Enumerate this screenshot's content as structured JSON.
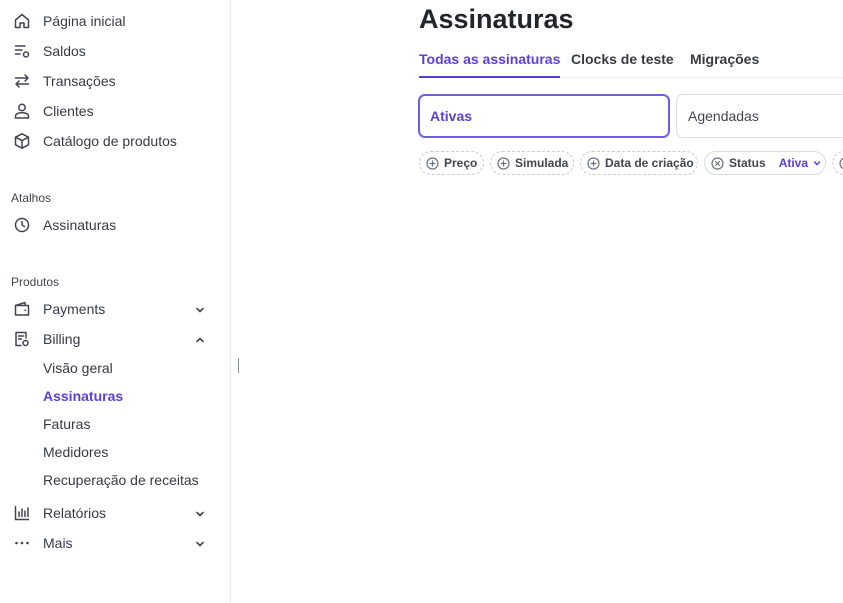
{
  "sidebar": {
    "nav": [
      {
        "label": "Página inicial",
        "icon": "home-icon"
      },
      {
        "label": "Saldos",
        "icon": "balance-icon"
      },
      {
        "label": "Transações",
        "icon": "transactions-icon"
      },
      {
        "label": "Clientes",
        "icon": "customer-icon"
      },
      {
        "label": "Catálogo de produtos",
        "icon": "product-box-icon"
      }
    ],
    "shortcuts_title": "Atalhos",
    "shortcuts": [
      {
        "label": "Assinaturas",
        "icon": "clock-icon"
      }
    ],
    "products_title": "Produtos",
    "products": [
      {
        "label": "Payments",
        "icon": "wallet-icon",
        "expanded": false
      },
      {
        "label": "Billing",
        "icon": "invoice-icon",
        "expanded": true
      },
      {
        "label": "Relatórios",
        "icon": "bar-chart-icon",
        "expanded": false
      },
      {
        "label": "Mais",
        "icon": "more-dots-icon",
        "expanded": false
      }
    ],
    "billing_subitems": [
      {
        "label": "Visão geral"
      },
      {
        "label": "Assinaturas",
        "active": true
      },
      {
        "label": "Faturas"
      },
      {
        "label": "Medidores"
      },
      {
        "label": "Recuperação de receitas"
      }
    ]
  },
  "main": {
    "title": "Assinaturas",
    "tabs": [
      {
        "label": "Todas as assinaturas",
        "active": true
      },
      {
        "label": "Clocks de teste"
      },
      {
        "label": "Migrações"
      }
    ],
    "status_cards": [
      {
        "label": "Ativas",
        "selected": true
      },
      {
        "label": "Agendadas"
      }
    ],
    "filters": [
      {
        "label": "Preço",
        "icon": "plus-circle-icon"
      },
      {
        "label": "Simulada",
        "icon": "plus-circle-icon"
      },
      {
        "label": "Data de criação",
        "icon": "plus-circle-icon"
      },
      {
        "label": "Status",
        "icon": "x-circle-icon",
        "value": "Ativa"
      }
    ]
  },
  "colors": {
    "accent": "#5b3fd6",
    "text": "#353a44",
    "border": "#d8dce3"
  }
}
